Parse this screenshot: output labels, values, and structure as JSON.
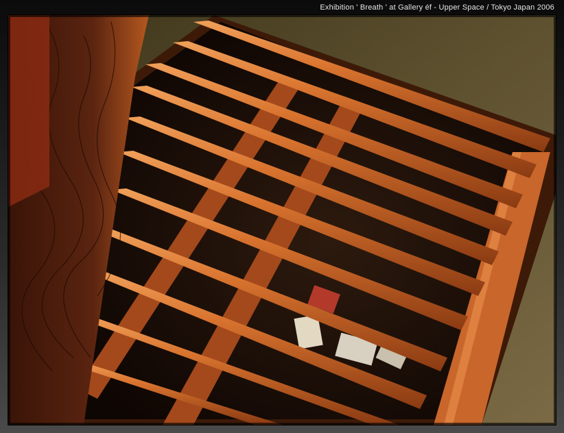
{
  "caption": "Exhibition  ' Breath '  at  Gallery éf - Upper Space  /   Tokyo Japan   2006",
  "photo": {
    "subject": "wooden slatted floor grate viewed from above",
    "colors": {
      "wood": "#c8642a",
      "wood_light": "#e08a45",
      "wood_dark": "#7a3412",
      "floor": "#5b4d2c",
      "shadow": "#120804"
    }
  }
}
